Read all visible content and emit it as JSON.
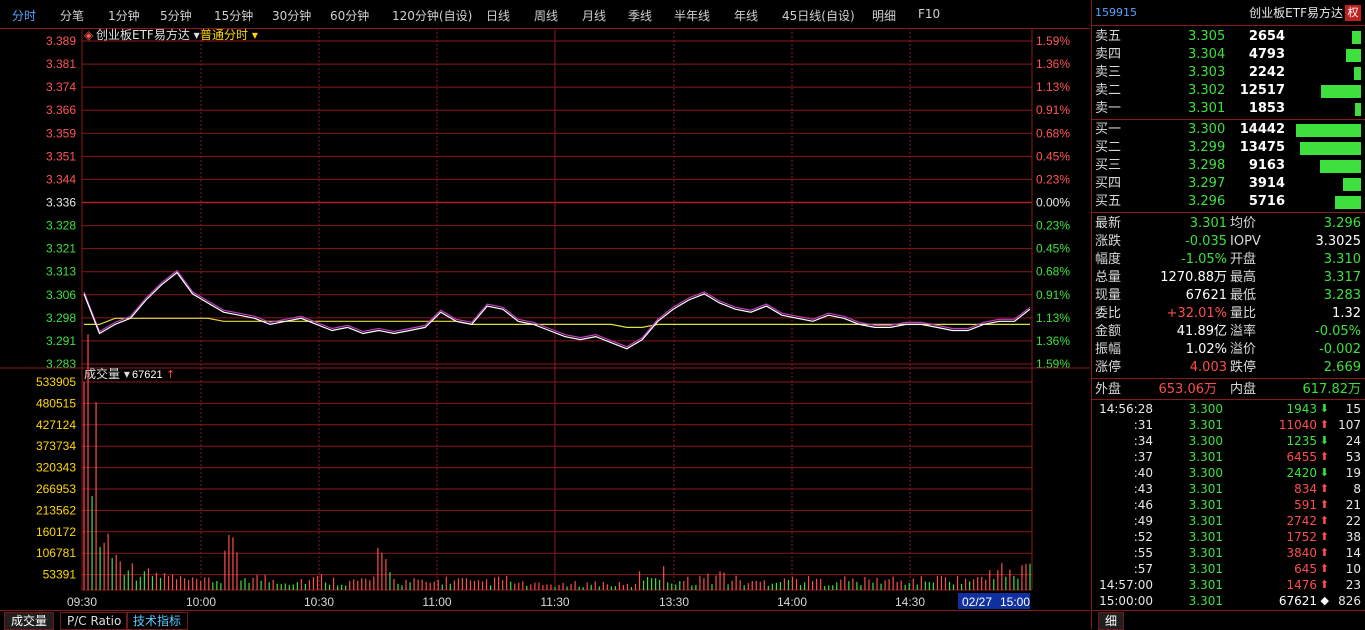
{
  "tabs": [
    "分时",
    "分笔",
    "1分钟",
    "5分钟",
    "15分钟",
    "30分钟",
    "60分钟",
    "120分钟(自设)",
    "日线",
    "周线",
    "月线",
    "季线",
    "半年线",
    "年线",
    "45日线(自设)",
    "明细",
    "F10"
  ],
  "active_tab": "分时",
  "chart": {
    "instrument_label": "创业板ETF易方达",
    "mode_label": "普通分时",
    "volume_label": "成交量",
    "volume_value": "67621",
    "price_ticks": [
      "3.389",
      "3.381",
      "3.374",
      "3.366",
      "3.359",
      "3.351",
      "3.344",
      "3.336",
      "3.328",
      "3.321",
      "3.313",
      "3.306",
      "3.298",
      "3.291",
      "3.283"
    ],
    "pct_ticks": [
      "1.59%",
      "1.36%",
      "1.13%",
      "0.91%",
      "0.68%",
      "0.45%",
      "0.23%",
      "0.00%",
      "0.23%",
      "0.45%",
      "0.68%",
      "0.91%",
      "1.13%",
      "1.36%",
      "1.59%"
    ],
    "vol_ticks": [
      "533905",
      "480515",
      "427124",
      "373734",
      "320343",
      "266953",
      "213562",
      "160172",
      "106781",
      "53391"
    ],
    "time_ticks": [
      "09:30",
      "10:00",
      "10:30",
      "11:00",
      "11:30",
      "13:30",
      "14:00",
      "14:30",
      "15:00"
    ],
    "date_badge": "02/27",
    "colors": {
      "grid": "#8a1a1a",
      "price_line": "#ffffff",
      "nav_line": "#c040c0",
      "avg_line": "#e0e040",
      "up": "#ff4d4d",
      "down": "#3ee03e"
    }
  },
  "chart_data": {
    "type": "line",
    "title": "",
    "ylim": [
      3.283,
      3.389
    ],
    "prev_close": 3.336,
    "series": [
      {
        "name": "price",
        "values": [
          3.306,
          3.293,
          3.296,
          3.298,
          3.304,
          3.309,
          3.313,
          3.306,
          3.303,
          3.3,
          3.299,
          3.298,
          3.296,
          3.297,
          3.298,
          3.296,
          3.294,
          3.295,
          3.293,
          3.294,
          3.293,
          3.294,
          3.295,
          3.3,
          3.297,
          3.296,
          3.302,
          3.301,
          3.297,
          3.296,
          3.294,
          3.292,
          3.291,
          3.292,
          3.29,
          3.288,
          3.291,
          3.297,
          3.301,
          3.304,
          3.306,
          3.303,
          3.301,
          3.3,
          3.302,
          3.299,
          3.298,
          3.297,
          3.299,
          3.298,
          3.296,
          3.295,
          3.295,
          3.296,
          3.296,
          3.295,
          3.294,
          3.294,
          3.296,
          3.297,
          3.297,
          3.301
        ]
      },
      {
        "name": "average",
        "values": [
          3.296,
          3.296,
          3.298,
          3.298,
          3.298,
          3.298,
          3.298,
          3.298,
          3.298,
          3.297,
          3.297,
          3.297,
          3.297,
          3.297,
          3.297,
          3.297,
          3.297,
          3.297,
          3.297,
          3.297,
          3.297,
          3.297,
          3.297,
          3.297,
          3.297,
          3.296,
          3.296,
          3.296,
          3.296,
          3.296,
          3.296,
          3.296,
          3.296,
          3.296,
          3.296,
          3.295,
          3.295,
          3.296,
          3.296,
          3.296,
          3.296,
          3.296,
          3.296,
          3.296,
          3.296,
          3.296,
          3.296,
          3.296,
          3.296,
          3.296,
          3.296,
          3.296,
          3.296,
          3.296,
          3.296,
          3.296,
          3.296,
          3.296,
          3.296,
          3.296,
          3.296,
          3.296
        ]
      },
      {
        "name": "volume",
        "values": [
          533905,
          150000,
          90000,
          60000,
          45000,
          40000,
          30000,
          25000,
          30000,
          110000,
          40000,
          35000,
          30000,
          25000,
          30000,
          35000,
          28000,
          25000,
          30000,
          85000,
          28000,
          25000,
          22000,
          30000,
          28000,
          20000,
          26000,
          30000,
          18000,
          15000,
          16000,
          14000,
          18000,
          20000,
          16000,
          14000,
          42000,
          50000,
          30000,
          28000,
          35000,
          45000,
          30000,
          22000,
          25000,
          35000,
          30000,
          28000,
          25000,
          30000,
          26000,
          28000,
          30000,
          25000,
          28000,
          32000,
          35000,
          30000,
          32000,
          60000,
          45000,
          67621
        ]
      }
    ]
  },
  "quote": {
    "code": "159915",
    "name": "创业板ETF易方达",
    "badge": "权",
    "asks": [
      {
        "label": "卖五",
        "price": "3.305",
        "vol": "2654",
        "bar": 0.13
      },
      {
        "label": "卖四",
        "price": "3.304",
        "vol": "4793",
        "bar": 0.23
      },
      {
        "label": "卖三",
        "price": "3.303",
        "vol": "2242",
        "bar": 0.11
      },
      {
        "label": "卖二",
        "price": "3.302",
        "vol": "12517",
        "bar": 0.6
      },
      {
        "label": "卖一",
        "price": "3.301",
        "vol": "1853",
        "bar": 0.09
      }
    ],
    "bids": [
      {
        "label": "买一",
        "price": "3.300",
        "vol": "14442",
        "bar": 0.98
      },
      {
        "label": "买二",
        "price": "3.299",
        "vol": "13475",
        "bar": 0.92
      },
      {
        "label": "买三",
        "price": "3.298",
        "vol": "9163",
        "bar": 0.62
      },
      {
        "label": "买四",
        "price": "3.297",
        "vol": "3914",
        "bar": 0.27
      },
      {
        "label": "买五",
        "price": "3.296",
        "vol": "5716",
        "bar": 0.39
      }
    ],
    "stats": [
      {
        "l1": "最新",
        "v1": "3.301",
        "c1": "g",
        "l2": "均价",
        "v2": "3.296",
        "c2": "g"
      },
      {
        "l1": "涨跌",
        "v1": "-0.035",
        "c1": "g",
        "l2": "IOPV",
        "v2": "3.3025",
        "c2": "w"
      },
      {
        "l1": "幅度",
        "v1": "-1.05%",
        "c1": "g",
        "l2": "开盘",
        "v2": "3.310",
        "c2": "g"
      },
      {
        "l1": "总量",
        "v1": "1270.88万",
        "c1": "w",
        "l2": "最高",
        "v2": "3.317",
        "c2": "g"
      },
      {
        "l1": "现量",
        "v1": "67621",
        "c1": "w",
        "l2": "最低",
        "v2": "3.283",
        "c2": "g"
      },
      {
        "l1": "委比",
        "v1": "+32.01%",
        "c1": "r",
        "l2": "量比",
        "v2": "1.32",
        "c2": "w"
      },
      {
        "l1": "金额",
        "v1": "41.89亿",
        "c1": "w",
        "l2": "溢率",
        "v2": "-0.05%",
        "c2": "g"
      },
      {
        "l1": "振幅",
        "v1": "1.02%",
        "c1": "w",
        "l2": "溢价",
        "v2": "-0.002",
        "c2": "g"
      },
      {
        "l1": "涨停",
        "v1": "4.003",
        "c1": "r",
        "l2": "跌停",
        "v2": "2.669",
        "c2": "g"
      }
    ],
    "outer_label": "外盘",
    "outer_value": "653.06万",
    "inner_label": "内盘",
    "inner_value": "617.82万",
    "ticks": [
      {
        "t": "14:56:28",
        "p": "3.300",
        "pc": "g",
        "v": "1943",
        "vc": "g",
        "a": "⬇",
        "n": "15"
      },
      {
        "t": ":31",
        "p": "3.301",
        "pc": "g",
        "v": "11040",
        "vc": "r",
        "a": "⬆",
        "n": "107"
      },
      {
        "t": ":34",
        "p": "3.300",
        "pc": "g",
        "v": "1235",
        "vc": "g",
        "a": "⬇",
        "n": "24"
      },
      {
        "t": ":37",
        "p": "3.301",
        "pc": "g",
        "v": "6455",
        "vc": "r",
        "a": "⬆",
        "n": "53"
      },
      {
        "t": ":40",
        "p": "3.300",
        "pc": "g",
        "v": "2420",
        "vc": "g",
        "a": "⬇",
        "n": "19"
      },
      {
        "t": ":43",
        "p": "3.301",
        "pc": "g",
        "v": "834",
        "vc": "r",
        "a": "⬆",
        "n": "8"
      },
      {
        "t": ":46",
        "p": "3.301",
        "pc": "g",
        "v": "591",
        "vc": "r",
        "a": "⬆",
        "n": "21"
      },
      {
        "t": ":49",
        "p": "3.301",
        "pc": "g",
        "v": "2742",
        "vc": "r",
        "a": "⬆",
        "n": "22"
      },
      {
        "t": ":52",
        "p": "3.301",
        "pc": "g",
        "v": "1752",
        "vc": "r",
        "a": "⬆",
        "n": "38"
      },
      {
        "t": ":55",
        "p": "3.301",
        "pc": "g",
        "v": "3840",
        "vc": "r",
        "a": "⬆",
        "n": "14"
      },
      {
        "t": ":57",
        "p": "3.301",
        "pc": "g",
        "v": "645",
        "vc": "r",
        "a": "⬆",
        "n": "10"
      },
      {
        "t": "14:57:00",
        "p": "3.301",
        "pc": "g",
        "v": "1476",
        "vc": "r",
        "a": "⬆",
        "n": "23"
      },
      {
        "t": "15:00:00",
        "p": "3.301",
        "pc": "g",
        "v": "67621",
        "vc": "w",
        "a": "◆",
        "n": "826"
      }
    ],
    "detail_tab": "细"
  },
  "bottom_tabs": [
    "成交量",
    "P/C Ratio",
    "技术指标"
  ]
}
